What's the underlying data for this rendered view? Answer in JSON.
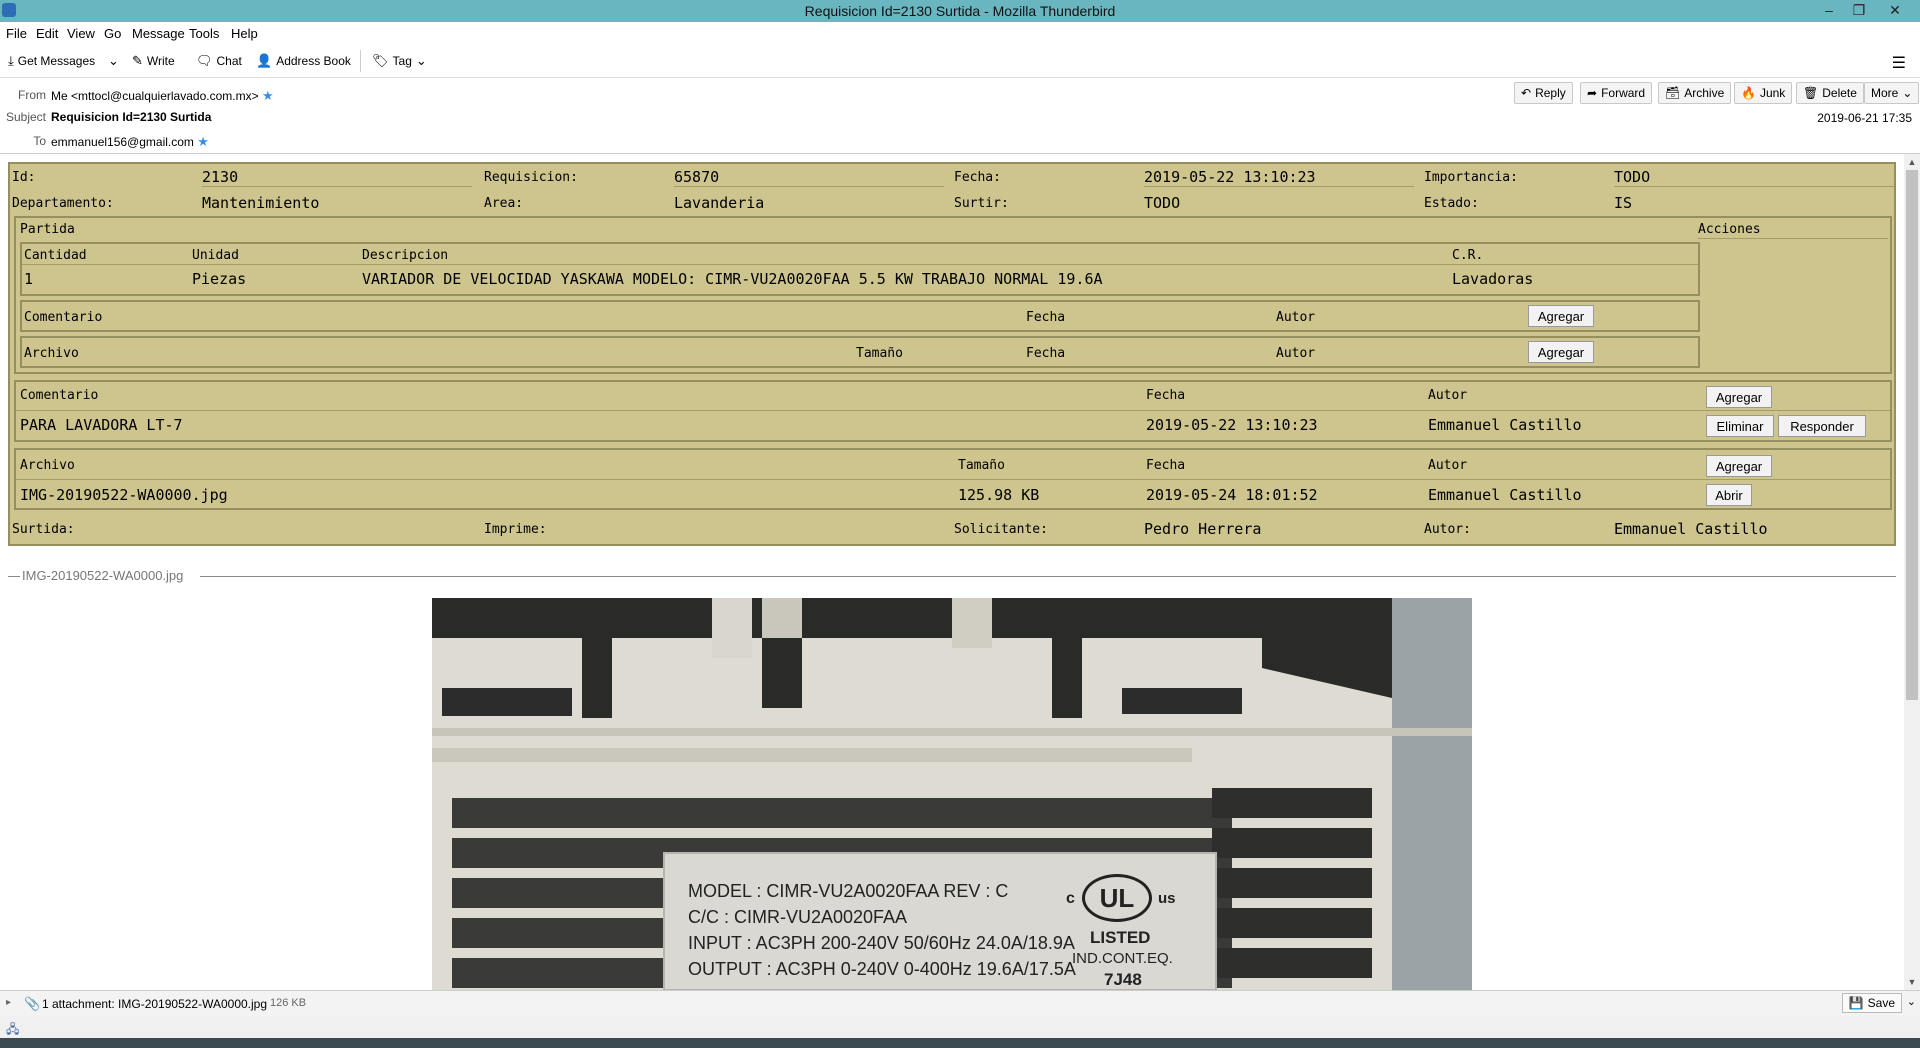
{
  "window": {
    "title": "Requisicion Id=2130 Surtida - Mozilla Thunderbird",
    "minimize": "–",
    "maximize": "❐",
    "close": "✕"
  },
  "menu": [
    "File",
    "Edit",
    "View",
    "Go",
    "Message",
    "Tools",
    "Help"
  ],
  "toolbar": {
    "get_messages": "Get Messages",
    "write": "Write",
    "chat": "Chat",
    "address_book": "Address Book",
    "tag": "Tag"
  },
  "header": {
    "from_label": "From",
    "from_value": "Me <mttocl@cualquierlavado.com.mx>",
    "subject_label": "Subject",
    "subject_value": "Requisicion Id=2130 Surtida",
    "to_label": "To",
    "to_value": "emmanuel156@gmail.com",
    "date": "2019-06-21 17:35",
    "actions": [
      "Reply",
      "Forward",
      "Archive",
      "Junk",
      "Delete",
      "More"
    ]
  },
  "requisition": {
    "id_label": "Id:",
    "id_value": "2130",
    "req_label": "Requisicion:",
    "req_value": "65870",
    "fecha_label": "Fecha:",
    "fecha_value": "2019-05-22 13:10:23",
    "imp_label": "Importancia:",
    "imp_value": "TODO",
    "dep_label": "Departamento:",
    "dep_value": "Mantenimiento",
    "area_label": "Area:",
    "area_value": "Lavanderia",
    "surtir_label": "Surtir:",
    "surtir_value": "TODO",
    "estado_label": "Estado:",
    "estado_value": "IS",
    "partida": {
      "title": "Partida",
      "acciones": "Acciones",
      "headers": [
        "Cantidad",
        "Unidad",
        "Descripcion",
        "C.R."
      ],
      "row": [
        "1",
        "Piezas",
        "VARIADOR DE VELOCIDAD YASKAWA MODELO: CIMR-VU2A0020FAA 5.5 KW TRABAJO NORMAL 19.6A",
        "Lavadoras"
      ],
      "comentario_label": "Comentario",
      "fecha_label": "Fecha",
      "autor_label": "Autor",
      "archivo_label": "Archivo",
      "tamano_label": "Tamaño",
      "agregar": "Agregar"
    },
    "comentarios": {
      "headers": [
        "Comentario",
        "Fecha",
        "Autor"
      ],
      "agregar": "Agregar",
      "row": [
        "PARA LAVADORA LT-7",
        "2019-05-22 13:10:23",
        "Emmanuel Castillo"
      ],
      "eliminar": "Eliminar",
      "responder": "Responder"
    },
    "archivos": {
      "headers": [
        "Archivo",
        "Tamaño",
        "Fecha",
        "Autor"
      ],
      "agregar": "Agregar",
      "row": [
        "IMG-20190522-WA0000.jpg",
        "125.98 KB",
        "2019-05-24 18:01:52",
        "Emmanuel Castillo"
      ],
      "abrir": "Abrir"
    },
    "surtida_label": "Surtida:",
    "imprime_label": "Imprime:",
    "solicitante_label": "Solicitante:",
    "solicitante_value": "Pedro Herrera",
    "autor_label": "Autor:",
    "autor_value": "Emmanuel Castillo"
  },
  "attachment_inline": {
    "name": "IMG-20190522-WA0000.jpg",
    "label_lines": [
      "MODEL : CIMR-VU2A0020FAA  REV : C",
      "C/C    : CIMR-VU2A0020FAA",
      "INPUT  : AC3PH 200-240V 50/60Hz 24.0A/18.9A",
      "OUTPUT : AC3PH 0-240V 0-400Hz 19.6A/17.5A"
    ],
    "ul_mark": "UL",
    "ul_c": "c",
    "ul_us": "us",
    "ul_listed": "LISTED",
    "ul_ind": "IND.CONT.EQ.",
    "ul_code": "7J48"
  },
  "statusbar": {
    "attachment_text": "1 attachment: IMG-20190522-WA0000.jpg",
    "size": "126 KB",
    "save": "Save"
  },
  "colors": {
    "titlebar": "#69b6c1",
    "req_background": "#cdc48e",
    "req_border": "#958e5e",
    "star": "#3a8fe0"
  }
}
